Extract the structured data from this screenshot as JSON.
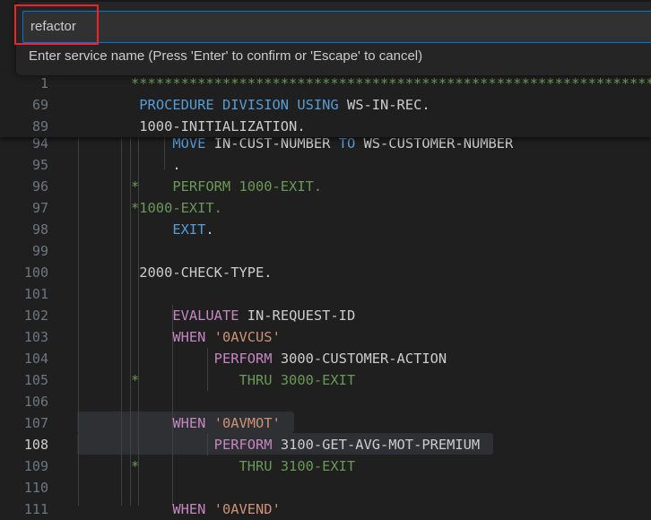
{
  "quick_input": {
    "value": "refactor",
    "message": "Enter service name (Press 'Enter' to confirm or 'Escape' to cancel)"
  },
  "colors": {
    "keyword": "#569cd6",
    "control": "#c586c0",
    "comment": "#6a9955",
    "string": "#ce9178",
    "highlight_box": "#e8262b",
    "focus_border": "#0078d4"
  },
  "sticky_lines": [
    {
      "n": "1",
      "parts": [
        {
          "t": "****************************************************************",
          "c": "cm"
        }
      ]
    },
    {
      "n": "69",
      "parts": [
        {
          "t": " "
        },
        {
          "t": "PROCEDURE DIVISION USING",
          "c": "kw"
        },
        {
          "t": " WS-IN-REC."
        }
      ]
    },
    {
      "n": "89",
      "parts": [
        {
          "t": " 1000-INITIALIZATION."
        }
      ]
    }
  ],
  "lines": [
    {
      "n": "94",
      "parts": [
        {
          "t": "     "
        },
        {
          "t": "MOVE",
          "c": "kw"
        },
        {
          "t": " IN-CUST-NUMBER "
        },
        {
          "t": "TO",
          "c": "kw"
        },
        {
          "t": " WS-CUSTOMER-NUMBER"
        }
      ]
    },
    {
      "n": "95",
      "parts": [
        {
          "t": "     ."
        }
      ]
    },
    {
      "n": "96",
      "parts": [
        {
          "t": "*    PERFORM 1000-EXIT.",
          "c": "cm"
        }
      ]
    },
    {
      "n": "97",
      "parts": [
        {
          "t": "*1000-EXIT.",
          "c": "cm"
        }
      ]
    },
    {
      "n": "98",
      "parts": [
        {
          "t": "     "
        },
        {
          "t": "EXIT",
          "c": "kw"
        },
        {
          "t": "."
        }
      ]
    },
    {
      "n": "99",
      "parts": []
    },
    {
      "n": "100",
      "parts": [
        {
          "t": " 2000-CHECK-TYPE."
        }
      ]
    },
    {
      "n": "101",
      "parts": []
    },
    {
      "n": "102",
      "parts": [
        {
          "t": "     "
        },
        {
          "t": "EVALUATE",
          "c": "pf"
        },
        {
          "t": " IN-REQUEST-ID"
        }
      ]
    },
    {
      "n": "103",
      "parts": [
        {
          "t": "     "
        },
        {
          "t": "WHEN",
          "c": "pf"
        },
        {
          "t": " "
        },
        {
          "t": "'0AVCUS'",
          "c": "str"
        }
      ]
    },
    {
      "n": "104",
      "parts": [
        {
          "t": "          "
        },
        {
          "t": "PERFORM",
          "c": "pf"
        },
        {
          "t": " 3000-CUSTOMER-ACTION"
        }
      ]
    },
    {
      "n": "105",
      "parts": [
        {
          "t": "*            THRU 3000-EXIT",
          "c": "cm"
        }
      ]
    },
    {
      "n": "106",
      "parts": []
    },
    {
      "n": "107",
      "parts": [
        {
          "t": "     "
        },
        {
          "t": "WHEN",
          "c": "pf"
        },
        {
          "t": " "
        },
        {
          "t": "'0AVMOT'",
          "c": "str"
        }
      ]
    },
    {
      "n": "108",
      "active": true,
      "parts": [
        {
          "t": "          "
        },
        {
          "t": "PERFORM",
          "c": "pf"
        },
        {
          "t": " 3100-GET-AVG-MOT-PREMIUM"
        }
      ]
    },
    {
      "n": "109",
      "parts": [
        {
          "t": "*            THRU 3100-EXIT",
          "c": "cm"
        }
      ]
    },
    {
      "n": "110",
      "parts": []
    },
    {
      "n": "111",
      "parts": [
        {
          "t": "     "
        },
        {
          "t": "WHEN",
          "c": "pf"
        },
        {
          "t": " "
        },
        {
          "t": "'0AVEND'",
          "c": "str"
        }
      ]
    }
  ]
}
